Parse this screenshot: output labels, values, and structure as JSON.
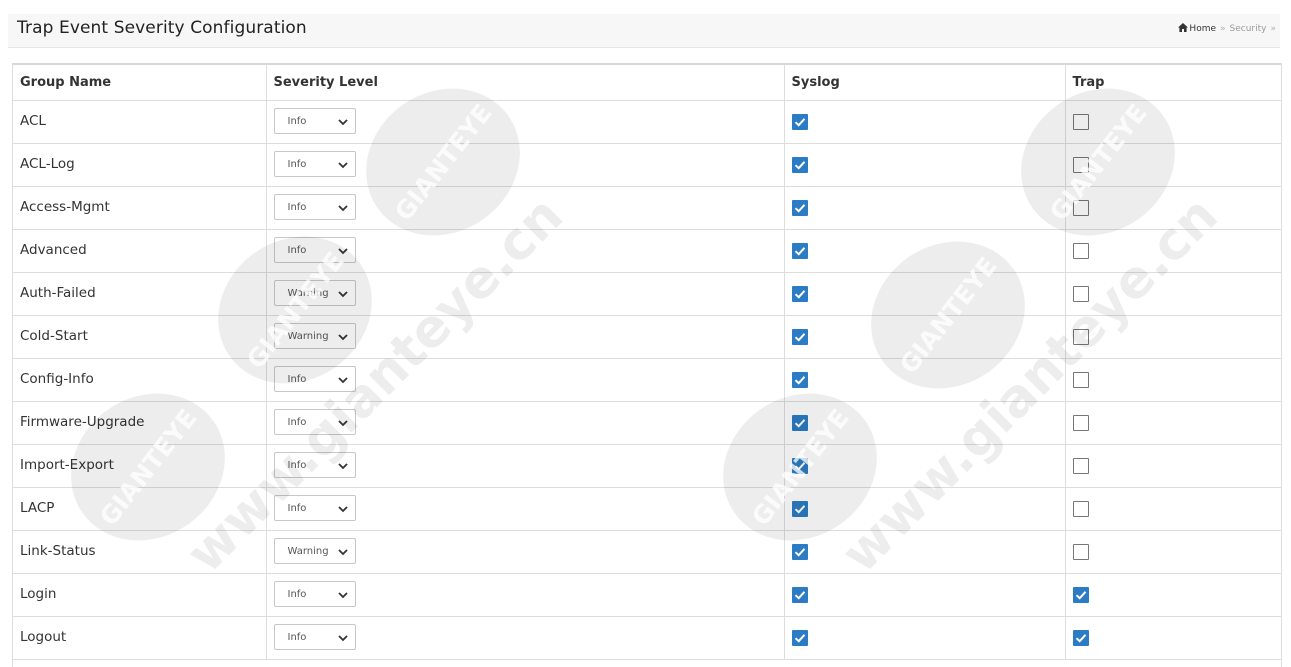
{
  "header": {
    "title": "Trap Event Severity Configuration",
    "breadcrumb": {
      "home": "Home",
      "current": "Security"
    }
  },
  "table": {
    "columns": [
      "Group Name",
      "Severity Level",
      "Syslog",
      "Trap"
    ],
    "rows": [
      {
        "name": "ACL",
        "severity": "Info",
        "syslog": true,
        "trap": false
      },
      {
        "name": "ACL-Log",
        "severity": "Info",
        "syslog": true,
        "trap": false
      },
      {
        "name": "Access-Mgmt",
        "severity": "Info",
        "syslog": true,
        "trap": false
      },
      {
        "name": "Advanced",
        "severity": "Info",
        "syslog": true,
        "trap": false
      },
      {
        "name": "Auth-Failed",
        "severity": "Warning",
        "syslog": true,
        "trap": false
      },
      {
        "name": "Cold-Start",
        "severity": "Warning",
        "syslog": true,
        "trap": false
      },
      {
        "name": "Config-Info",
        "severity": "Info",
        "syslog": true,
        "trap": false
      },
      {
        "name": "Firmware-Upgrade",
        "severity": "Info",
        "syslog": true,
        "trap": false
      },
      {
        "name": "Import-Export",
        "severity": "Info",
        "syslog": true,
        "trap": false
      },
      {
        "name": "LACP",
        "severity": "Info",
        "syslog": true,
        "trap": false
      },
      {
        "name": "Link-Status",
        "severity": "Warning",
        "syslog": true,
        "trap": false
      },
      {
        "name": "Login",
        "severity": "Info",
        "syslog": true,
        "trap": true
      },
      {
        "name": "Logout",
        "severity": "Info",
        "syslog": true,
        "trap": true
      }
    ]
  },
  "watermark": {
    "logo_text": "GIANTEYE",
    "site_text": "www.gianteye.cn"
  },
  "colors": {
    "checkbox_checked": "#2b7cc4",
    "header_bg": "#f7f7f7",
    "border": "#dddddd"
  }
}
